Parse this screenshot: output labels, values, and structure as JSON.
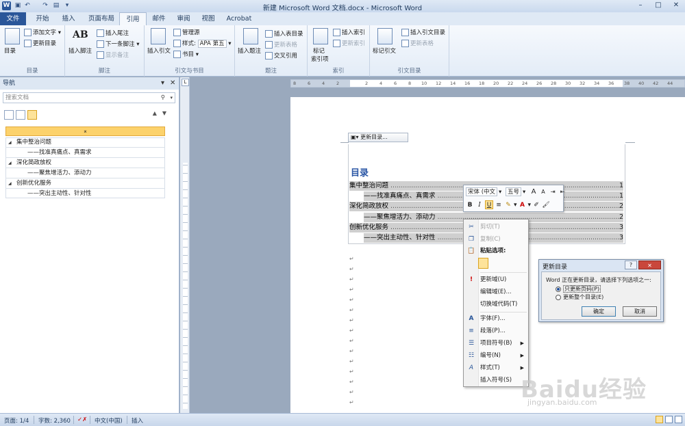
{
  "window": {
    "title": "新建 Microsoft Word 文档.docx  -  Microsoft Word",
    "app_icon": "W",
    "controls": [
      "–",
      "□",
      "✕"
    ]
  },
  "ribbon_tabs": [
    {
      "label": "文件"
    },
    {
      "label": "开始"
    },
    {
      "label": "插入"
    },
    {
      "label": "页面布局"
    },
    {
      "label": "引用"
    },
    {
      "label": "邮件"
    },
    {
      "label": "审阅"
    },
    {
      "label": "视图"
    },
    {
      "label": "Acrobat"
    }
  ],
  "ribbon": {
    "toc_group": {
      "label": "目录",
      "big": "目录",
      "add_text": "添加文字",
      "update": "更新目录"
    },
    "footnote_group": {
      "label": "脚注",
      "insert_footnote": "插入脚注",
      "insert_endnote": "插入尾注",
      "next_footnote": "下一条脚注",
      "show_notes": "显示备注",
      "ab": "AB"
    },
    "citation_group": {
      "label": "引文与书目",
      "insert_citation": "插入引文",
      "manage_sources": "管理源",
      "style_label": "样式:",
      "style_value": "APA 第五",
      "bibliography": "书目"
    },
    "caption_group": {
      "label": "题注",
      "insert_caption": "插入题注",
      "insert_tof": "插入表目录",
      "update_table": "更新表格",
      "cross_ref": "交叉引用"
    },
    "index_group": {
      "label": "索引",
      "mark_entry": "标记",
      "mark_entry2": "索引项",
      "insert_index": "插入索引",
      "update_index": "更新索引"
    },
    "toa_group": {
      "label": "引文目录",
      "mark_citation": "标记引文",
      "insert_toa": "插入引文目录",
      "update_table": "更新表格"
    }
  },
  "nav": {
    "title": "导航",
    "search_placeholder": "搜索文档",
    "items": [
      {
        "label": "集中整治问题",
        "level": 1
      },
      {
        "label": "——找准真痛点、真需求",
        "level": 2
      },
      {
        "label": "深化简政放权",
        "level": 1
      },
      {
        "label": "——聚焦增活力、添动力",
        "level": 2
      },
      {
        "label": "创新优化服务",
        "level": 1
      },
      {
        "label": "——突出主动性、针对性",
        "level": 2
      }
    ]
  },
  "ruler": {
    "ticks": [
      "8",
      "6",
      "4",
      "2",
      "",
      "2",
      "4",
      "6",
      "8",
      "10",
      "12",
      "14",
      "16",
      "18",
      "20",
      "22",
      "24",
      "26",
      "28",
      "30",
      "32",
      "34",
      "36",
      "38",
      "40",
      "42",
      "44",
      "46",
      "48"
    ]
  },
  "document": {
    "toc_toolbar_label": "更新目录...",
    "toc_title": "目录",
    "toc_entries": [
      {
        "text": "集中整治问题",
        "page": "1",
        "indent": false
      },
      {
        "text": "——找准真痛点、真需求",
        "page": "1",
        "indent": true
      },
      {
        "text": "深化简政放权",
        "page": "2",
        "indent": false
      },
      {
        "text": "——聚焦增活力、添动力",
        "page": "2",
        "indent": true
      },
      {
        "text": "创新优化服务",
        "page": "3",
        "indent": false
      },
      {
        "text": "——突出主动性、针对性",
        "page": "3",
        "indent": true
      }
    ],
    "para_mark": "↵"
  },
  "mini_toolbar": {
    "font": "宋体 (中文",
    "size": "五号",
    "grow": "A",
    "shrink": "A",
    "bold": "B",
    "italic": "I",
    "underline": "U",
    "font_color": "A"
  },
  "context_menu": {
    "items": [
      {
        "label": "剪切(T)",
        "disabled": true,
        "icon": "cut-icon",
        "glyph": "✂"
      },
      {
        "label": "复制(C)",
        "disabled": true,
        "icon": "copy-icon",
        "glyph": "❐"
      },
      {
        "label": "粘贴选项:",
        "disabled": false,
        "icon": "paste-icon",
        "glyph": "📋",
        "bold": true
      },
      {
        "label": "更新域(U)",
        "disabled": false,
        "icon": "update-field-icon",
        "glyph": "!"
      },
      {
        "label": "编辑域(E)...",
        "disabled": false,
        "icon": "",
        "glyph": ""
      },
      {
        "label": "切换域代码(T)",
        "disabled": false,
        "icon": "",
        "glyph": ""
      },
      {
        "label": "字体(F)...",
        "disabled": false,
        "icon": "font-icon",
        "glyph": "A"
      },
      {
        "label": "段落(P)...",
        "disabled": false,
        "icon": "paragraph-icon",
        "glyph": "≡"
      },
      {
        "label": "项目符号(B)",
        "disabled": false,
        "icon": "bullets-icon",
        "glyph": "☰",
        "submenu": true
      },
      {
        "label": "编号(N)",
        "disabled": false,
        "icon": "numbering-icon",
        "glyph": "☷",
        "submenu": true
      },
      {
        "label": "样式(T)",
        "disabled": false,
        "icon": "styles-icon",
        "glyph": "A",
        "submenu": true
      },
      {
        "label": "插入符号(S)",
        "disabled": false,
        "icon": "",
        "glyph": ""
      }
    ]
  },
  "dialog": {
    "title": "更新目录",
    "help": "?",
    "close": "✕",
    "message": "Word 正在更新目录，请选择下列选项之一:",
    "option1": "只更新页码(P)",
    "option2": "更新整个目录(E)",
    "selected": "option1",
    "ok": "确定",
    "cancel": "取消"
  },
  "status": {
    "page": "页面: 1/4",
    "words": "字数: 2,360",
    "language": "中文(中国)",
    "mode": "插入"
  },
  "watermark": {
    "main": "Baidu经验",
    "sub": "jingyan.baidu.com"
  }
}
